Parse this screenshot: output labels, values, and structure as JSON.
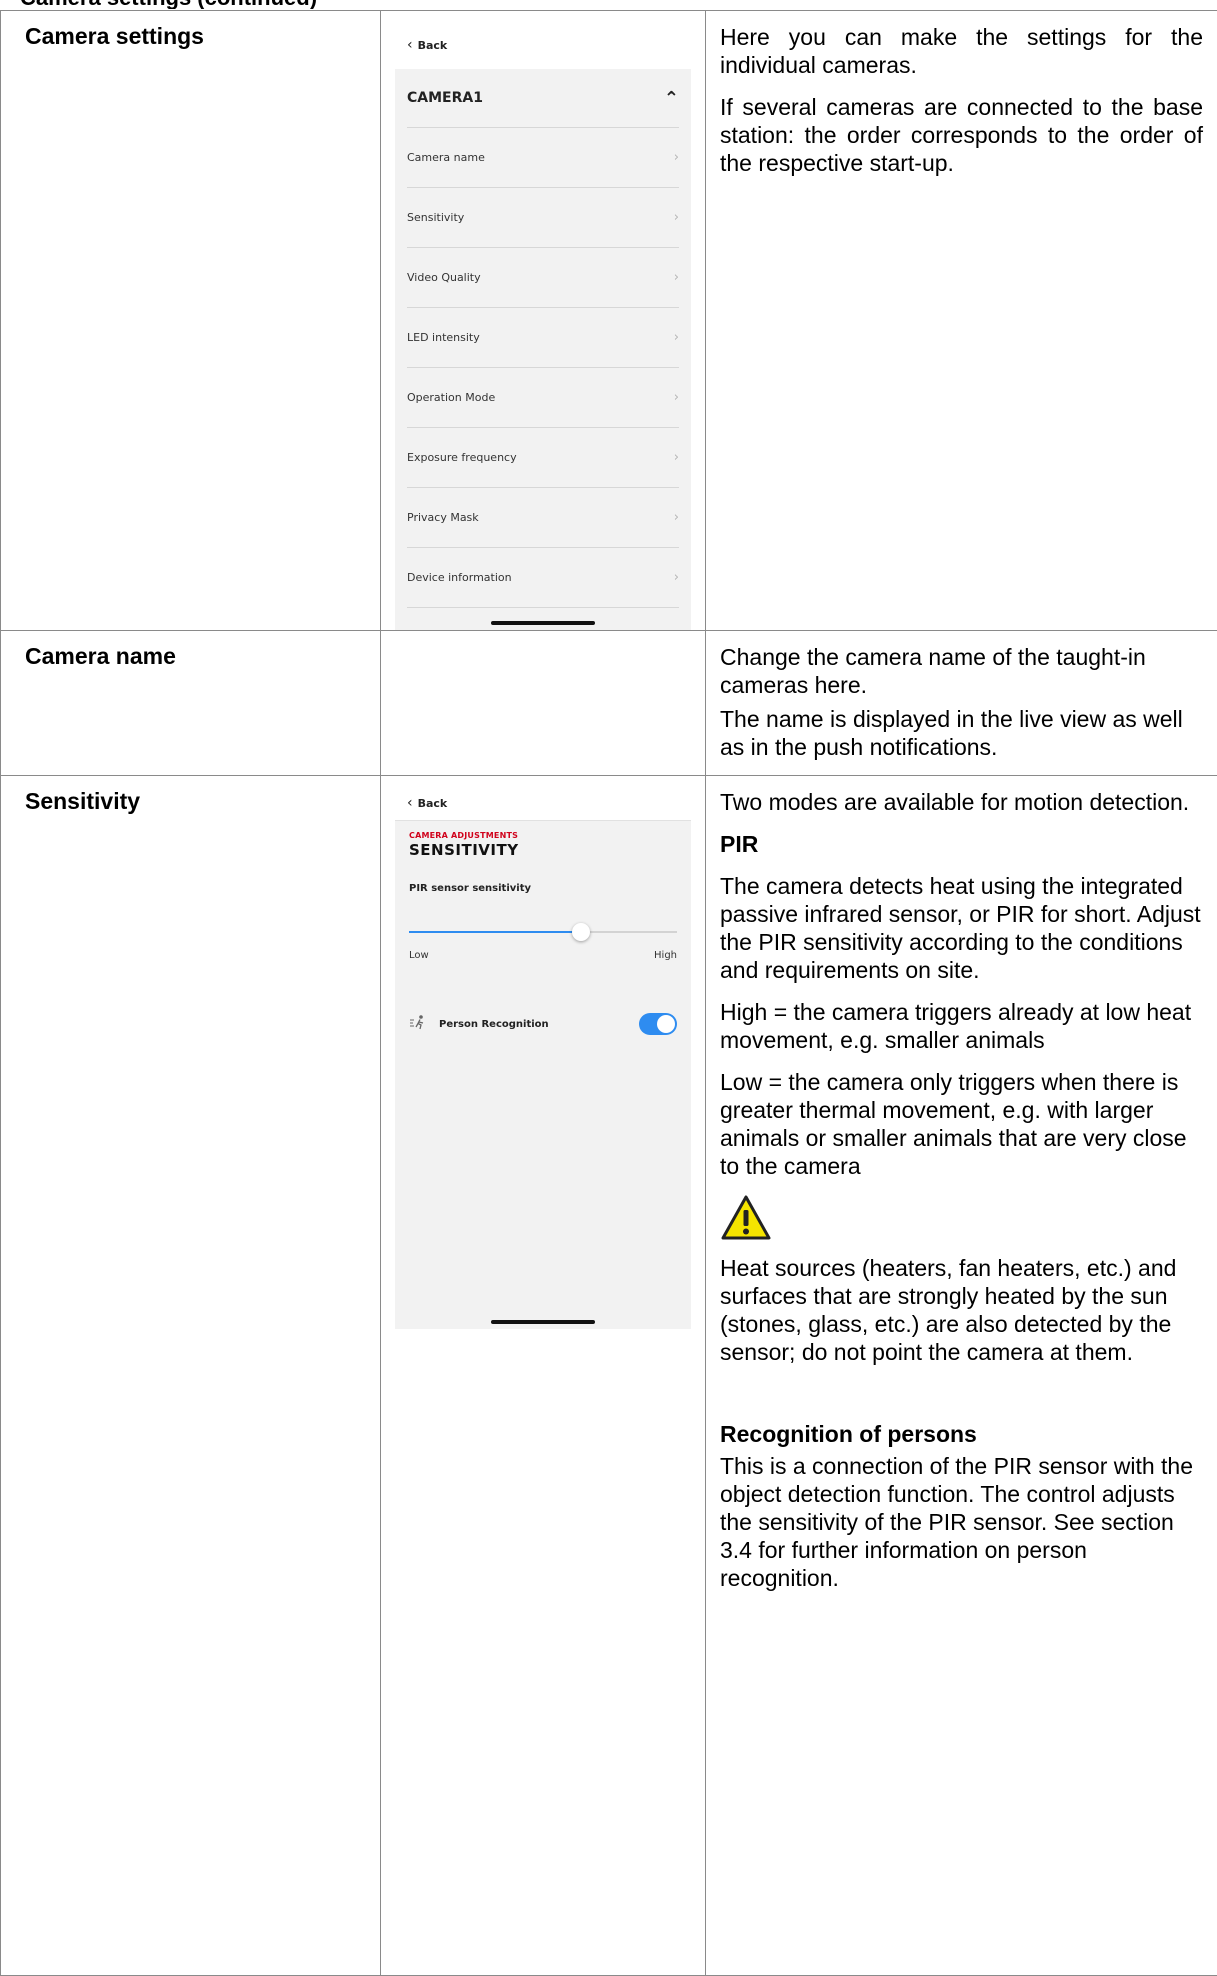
{
  "page_header_fragment": "Camera settings (continued)",
  "rows": [
    {
      "label": "Camera settings",
      "paragraphs": [
        "Here you can make the settings for the individual cameras.",
        "If several cameras are connected to the base station: the order corresponds to the order of the respective start-up."
      ]
    },
    {
      "label": "Camera name",
      "paragraphs": [
        "Change the camera name of the taught-in cameras here.",
        "The name is displayed in the live view as well as in the push notifications."
      ]
    },
    {
      "label": "Sensitivity",
      "intro": "Two modes are available for motion detection.",
      "pir_heading": "PIR",
      "pir_text": "The camera detects heat using the integrated passive infrared sensor, or PIR for short. Adjust the PIR sensitivity according to the conditions and requirements on site.",
      "high_text": "High = the camera triggers already at low heat movement, e.g. smaller animals",
      "low_text": "Low = the camera only triggers when there is greater thermal movement, e.g. with larger animals or smaller animals that are very close to the camera",
      "warning_text": "Heat sources (heaters, fan heaters, etc.) and surfaces that are strongly heated by the sun (stones, glass, etc.) are also detected by the sensor; do not point the camera at them.",
      "recog_heading": "Recognition of persons",
      "recog_text": "This is a connection of the PIR sensor with the object detection function. The control adjusts the sensitivity of the PIR sensor. See section 3.4 for further information on person recognition."
    }
  ],
  "camera_screen": {
    "back_label": "Back",
    "camera_title": "CAMERA1",
    "menu_items": [
      "Camera name",
      "Sensitivity",
      "Video Quality",
      "LED intensity",
      "Operation Mode",
      "Exposure frequency",
      "Privacy Mask",
      "Device information"
    ]
  },
  "sensitivity_screen": {
    "back_label": "Back",
    "kicker": "CAMERA ADJUSTMENTS",
    "title": "SENSITIVITY",
    "slider_label": "PIR sensor sensitivity",
    "slider_value_fraction": 0.64,
    "slider_low": "Low",
    "slider_high": "High",
    "person_recognition_label": "Person Recognition",
    "person_recognition_on": true,
    "accent_color": "#2e8cf0",
    "kicker_color": "#d0021b"
  }
}
